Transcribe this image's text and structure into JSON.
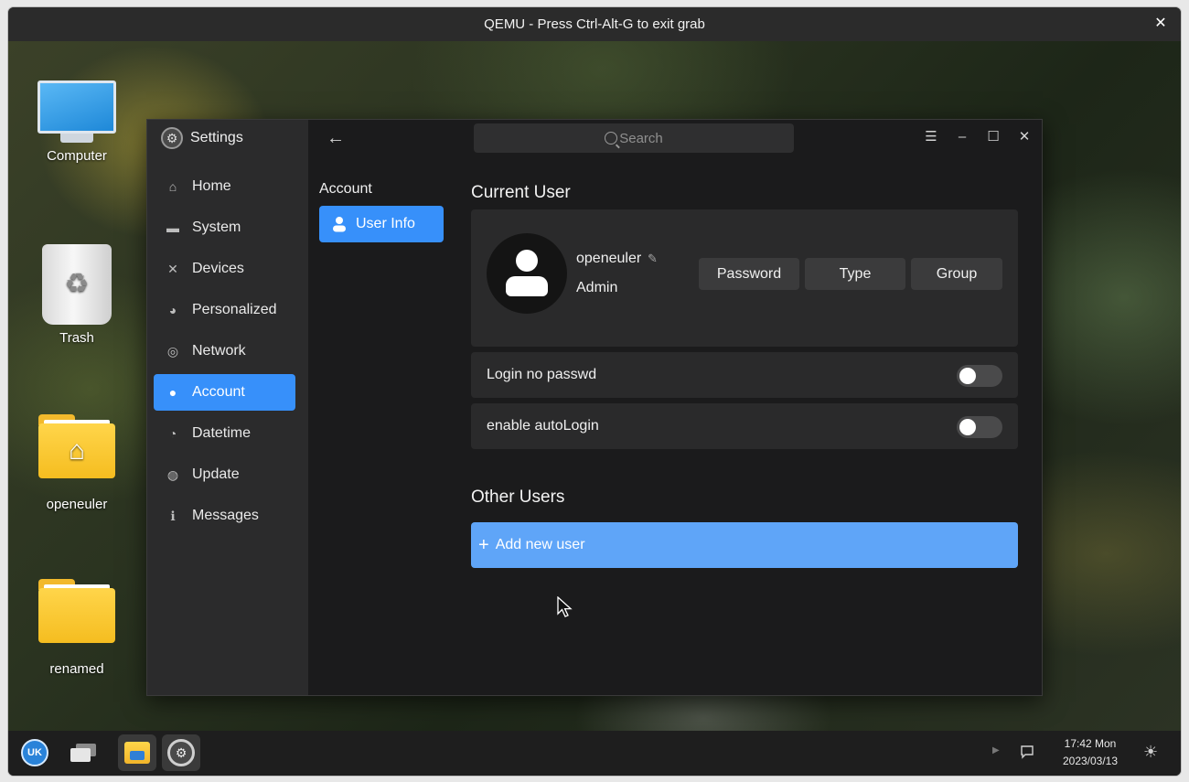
{
  "qemu": {
    "title": "QEMU - Press Ctrl-Alt-G to exit grab",
    "close_glyph": "✕"
  },
  "desktop_icons": [
    {
      "label": "Computer",
      "icon": "computer-icon"
    },
    {
      "label": "Trash",
      "icon": "trash-icon"
    },
    {
      "label": "openeuler",
      "icon": "home-folder-icon"
    },
    {
      "label": "renamed",
      "icon": "folder-icon"
    }
  ],
  "settings": {
    "app_title": "Settings",
    "nav": [
      {
        "label": "Home",
        "icon": "home-icon",
        "glyph": "⌂"
      },
      {
        "label": "System",
        "icon": "monitor-icon",
        "glyph": "▬"
      },
      {
        "label": "Devices",
        "icon": "tools-icon",
        "glyph": "✕"
      },
      {
        "label": "Personalized",
        "icon": "palette-icon",
        "glyph": "◕"
      },
      {
        "label": "Network",
        "icon": "globe-icon",
        "glyph": "◎"
      },
      {
        "label": "Account",
        "icon": "user-icon",
        "glyph": "●",
        "active": true
      },
      {
        "label": "Datetime",
        "icon": "clock-icon",
        "glyph": "◔"
      },
      {
        "label": "Update",
        "icon": "update-icon",
        "glyph": "◍"
      },
      {
        "label": "Messages",
        "icon": "info-icon",
        "glyph": "ℹ"
      }
    ],
    "subnav": {
      "heading": "Account",
      "item": "User Info"
    },
    "search": {
      "placeholder": "Search"
    },
    "current_user": {
      "section_title": "Current User",
      "username": "openeuler",
      "account_type": "Admin",
      "buttons": {
        "password": "Password",
        "type": "Type",
        "group": "Group"
      }
    },
    "toggles": [
      {
        "label": "Login no passwd",
        "enabled": false
      },
      {
        "label": "enable autoLogin",
        "enabled": false
      }
    ],
    "other_users": {
      "section_title": "Other Users",
      "add_label": "Add new user"
    }
  },
  "taskbar": {
    "start_label": "UK",
    "clock": {
      "time": "17:42 Mon",
      "date": "2023/03/13"
    }
  },
  "colors": {
    "accent": "#3790fa",
    "add_user_bg": "#5fa5f8",
    "sidebar_bg": "#2b2b2c",
    "window_bg": "#1b1b1c"
  }
}
